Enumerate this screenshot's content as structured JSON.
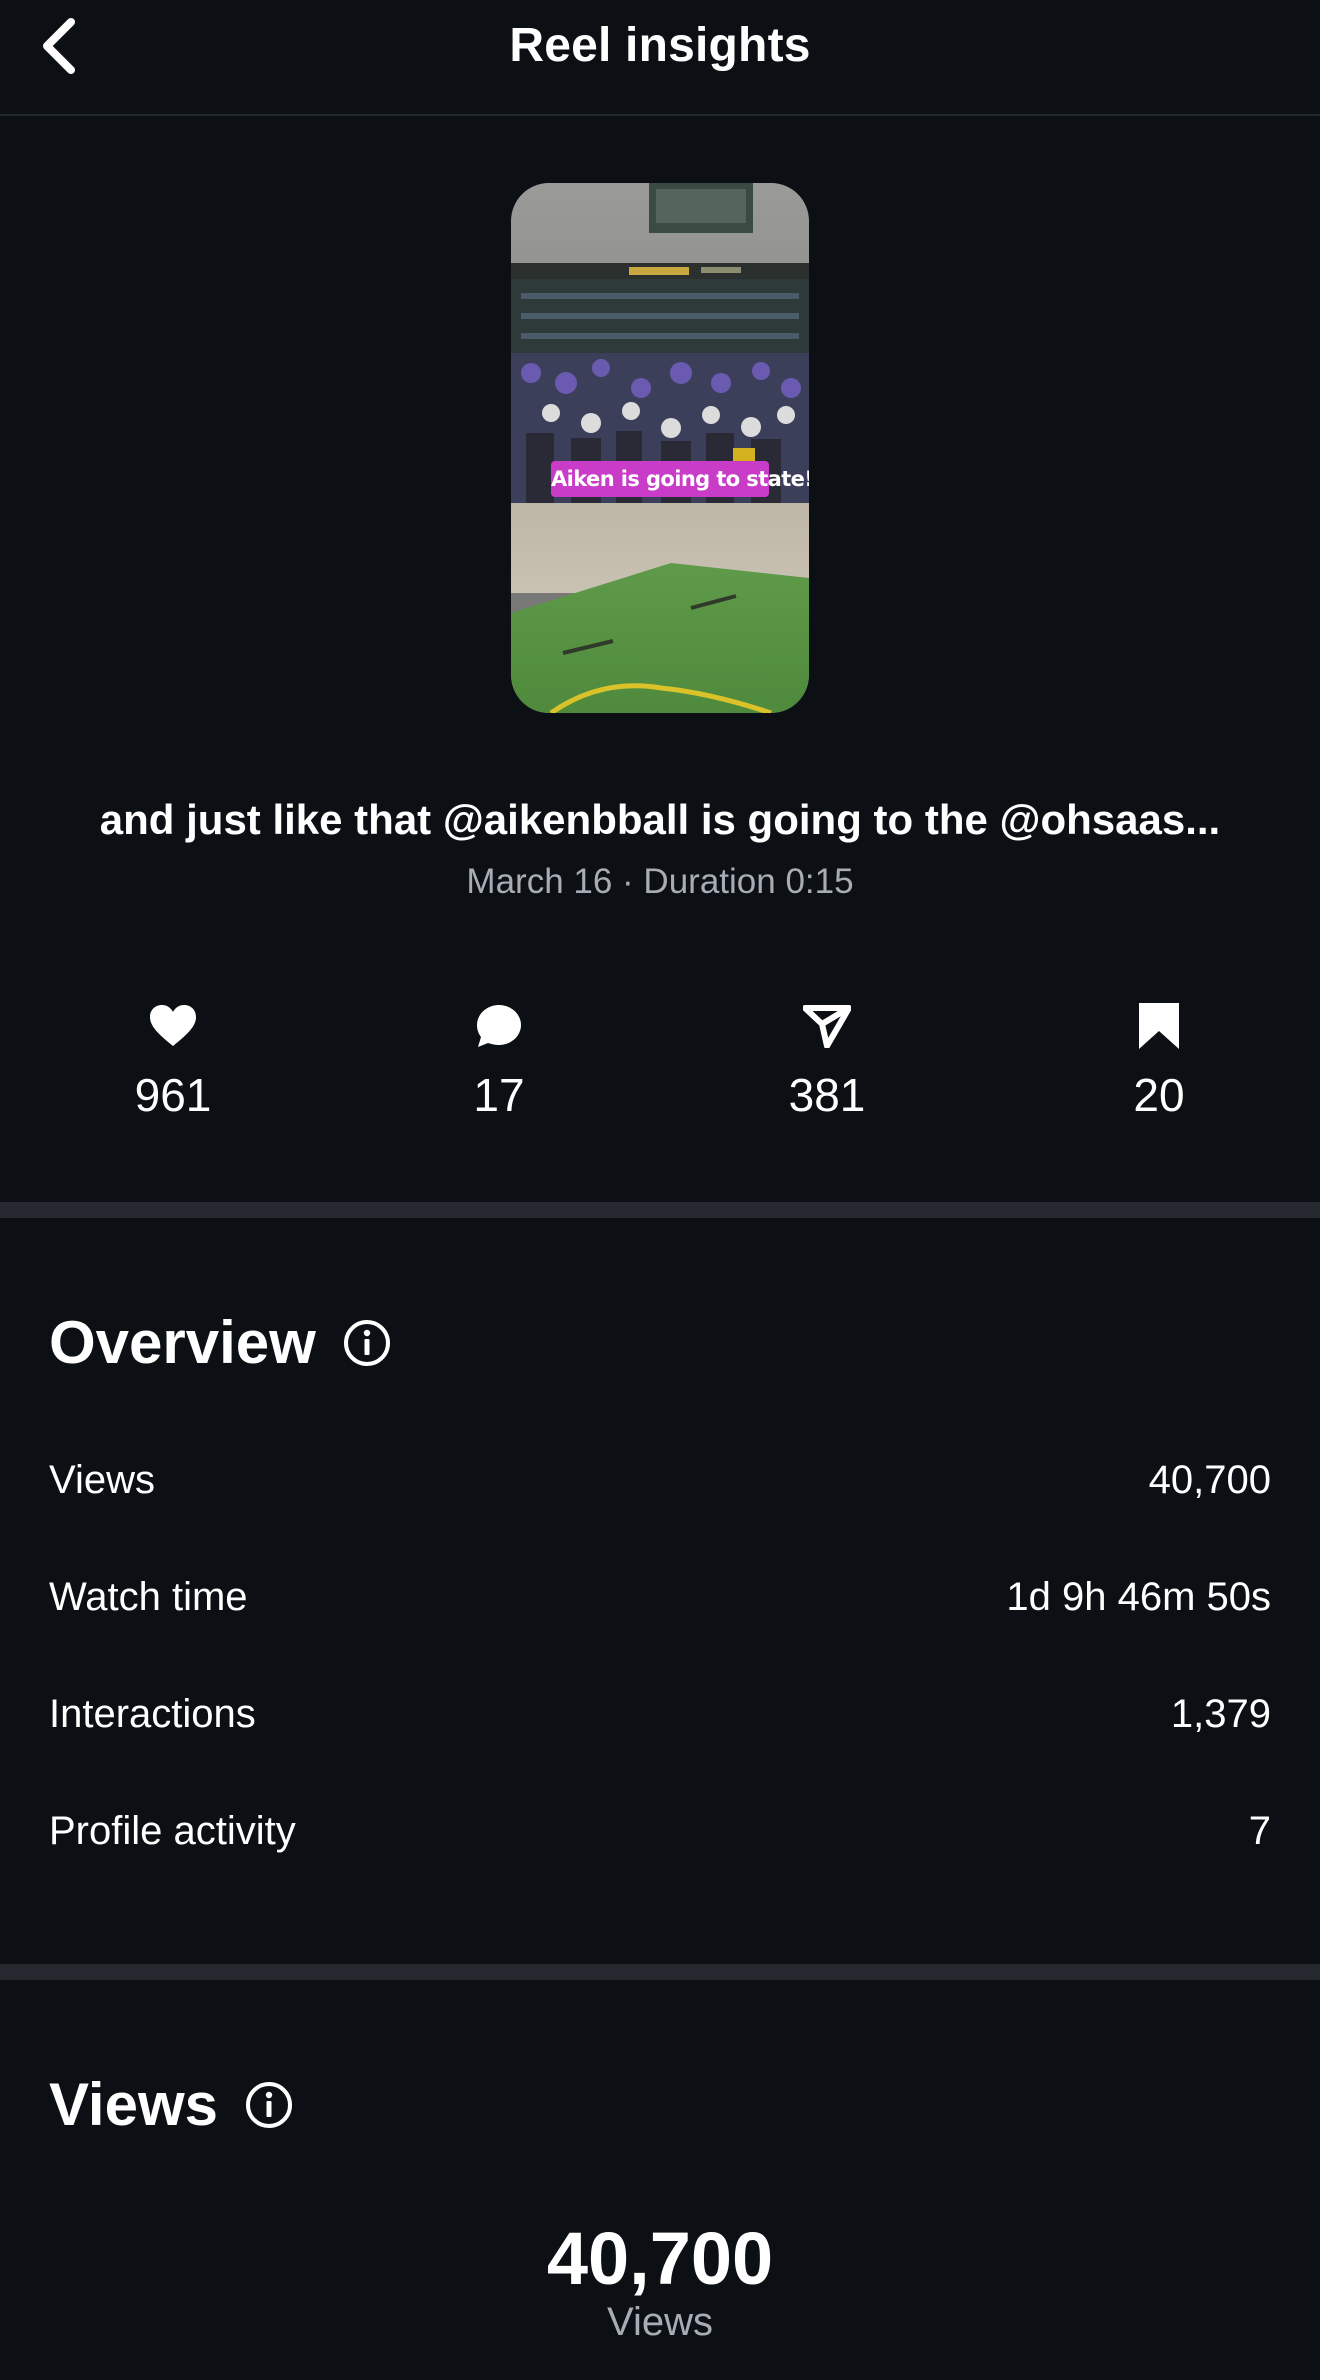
{
  "header": {
    "title": "Reel insights"
  },
  "reel": {
    "thumbnail_overlay_text": "Aiken is going to state!",
    "caption": "and just like that @aikenbball is going to the @ohsaas...",
    "meta": "March 16 · Duration 0:15"
  },
  "stats": {
    "likes": "961",
    "comments": "17",
    "shares": "381",
    "saves": "20"
  },
  "overview": {
    "title": "Overview",
    "rows": [
      {
        "label": "Views",
        "value": "40,700"
      },
      {
        "label": "Watch time",
        "value": "1d 9h 46m 50s"
      },
      {
        "label": "Interactions",
        "value": "1,379"
      },
      {
        "label": "Profile activity",
        "value": "7"
      }
    ]
  },
  "views": {
    "title": "Views",
    "total": "40,700",
    "total_label": "Views"
  },
  "colors": {
    "background": "#0c0f14",
    "divider": "#262a30",
    "muted_text": "#a8adb5"
  }
}
